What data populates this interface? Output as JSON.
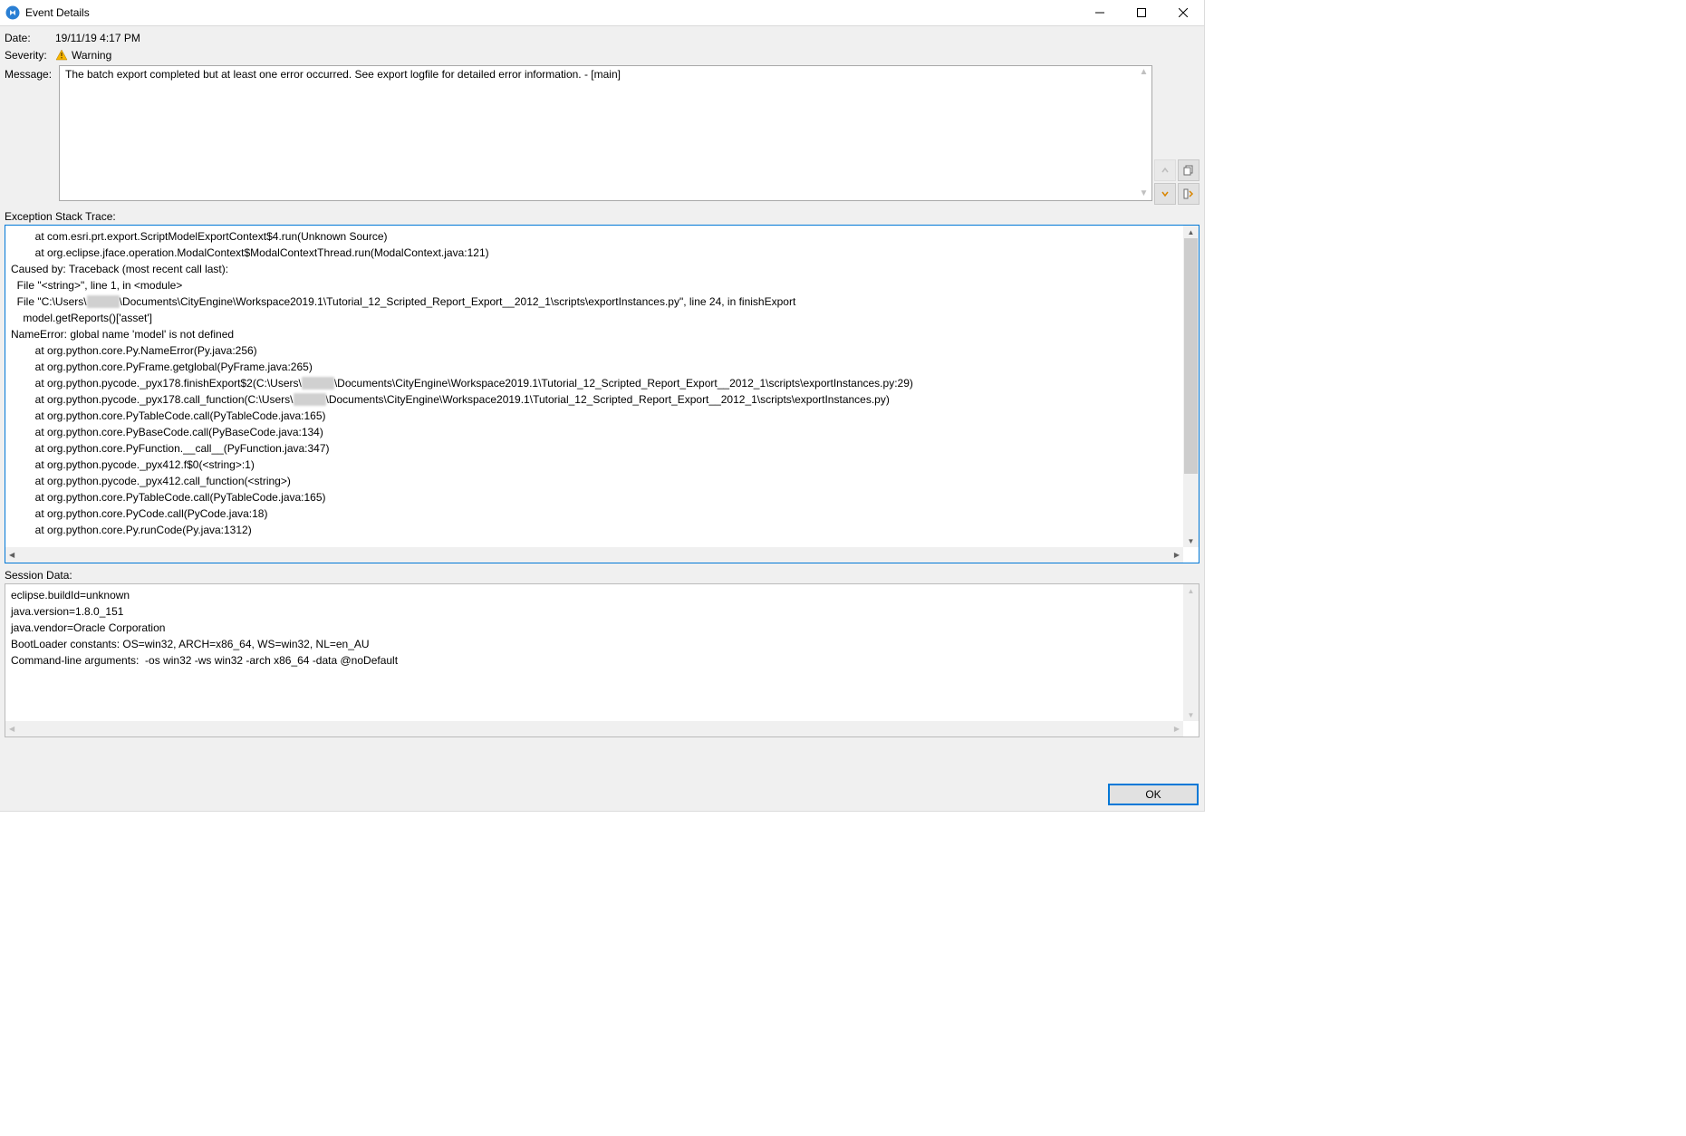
{
  "window": {
    "title": "Event Details"
  },
  "labels": {
    "date": "Date:",
    "severity": "Severity:",
    "message": "Message:",
    "stack_trace": "Exception Stack Trace:",
    "session_data": "Session Data:"
  },
  "values": {
    "date": "19/11/19 4:17 PM",
    "severity": "Warning",
    "message": "The batch export completed but at least one error occurred. See export logfile for detailed error information. - [main]"
  },
  "stack_trace": {
    "lines": [
      "        at com.esri.prt.export.ScriptModelExportContext$4.run(Unknown Source)",
      "        at org.eclipse.jface.operation.ModalContext$ModalContextThread.run(ModalContext.java:121)",
      "Caused by: Traceback (most recent call last):",
      "  File \"<string>\", line 1, in <module>",
      {
        "pre": "  File \"C:\\Users\\",
        "blur": "xxxxxx",
        "post": "\\Documents\\CityEngine\\Workspace2019.1\\Tutorial_12_Scripted_Report_Export__2012_1\\scripts\\exportInstances.py\", line 24, in finishExport"
      },
      "    model.getReports()['asset']",
      "NameError: global name 'model' is not defined",
      "",
      "        at org.python.core.Py.NameError(Py.java:256)",
      "        at org.python.core.PyFrame.getglobal(PyFrame.java:265)",
      {
        "pre": "        at org.python.pycode._pyx178.finishExport$2(C:\\Users\\",
        "blur": "xxxxxx",
        "post": "\\Documents\\CityEngine\\Workspace2019.1\\Tutorial_12_Scripted_Report_Export__2012_1\\scripts\\exportInstances.py:29)"
      },
      {
        "pre": "        at org.python.pycode._pyx178.call_function(C:\\Users\\",
        "blur": "xxxxxx",
        "post": "\\Documents\\CityEngine\\Workspace2019.1\\Tutorial_12_Scripted_Report_Export__2012_1\\scripts\\exportInstances.py)"
      },
      "        at org.python.core.PyTableCode.call(PyTableCode.java:165)",
      "        at org.python.core.PyBaseCode.call(PyBaseCode.java:134)",
      "        at org.python.core.PyFunction.__call__(PyFunction.java:347)",
      "        at org.python.pycode._pyx412.f$0(<string>:1)",
      "        at org.python.pycode._pyx412.call_function(<string>)",
      "        at org.python.core.PyTableCode.call(PyTableCode.java:165)",
      "        at org.python.core.PyCode.call(PyCode.java:18)",
      "        at org.python.core.Py.runCode(Py.java:1312)"
    ]
  },
  "session_data": {
    "lines": [
      "eclipse.buildId=unknown",
      "java.version=1.8.0_151",
      "java.vendor=Oracle Corporation",
      "BootLoader constants: OS=win32, ARCH=x86_64, WS=win32, NL=en_AU",
      "Command-line arguments:  -os win32 -ws win32 -arch x86_64 -data @noDefault"
    ]
  },
  "buttons": {
    "ok": "OK"
  }
}
